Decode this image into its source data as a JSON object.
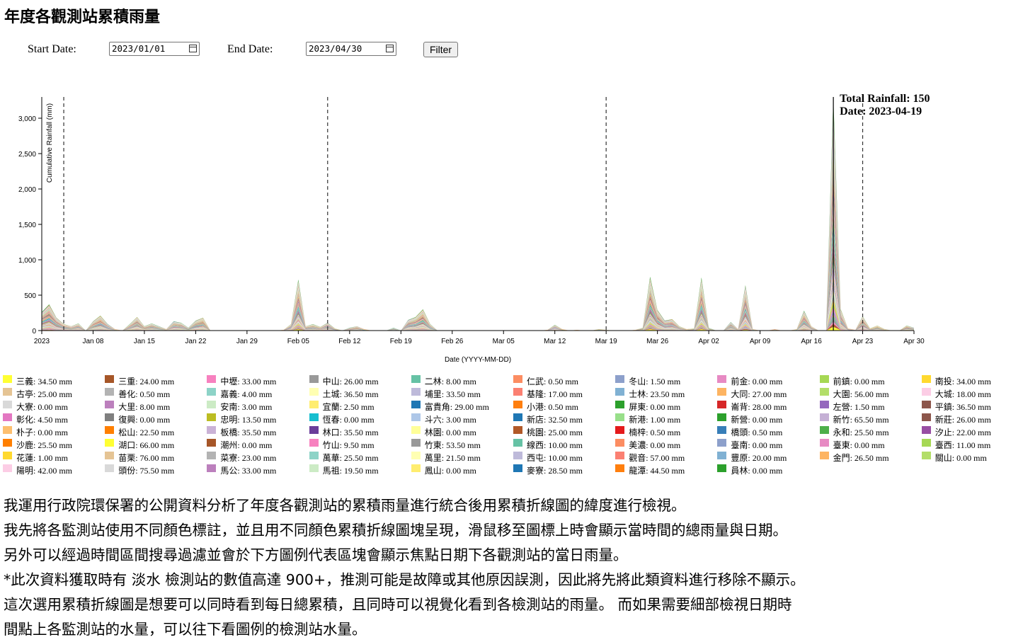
{
  "page_title": "年度各觀測站累積雨量",
  "filter": {
    "start_label": "Start Date:",
    "start_value": "2023/01/01",
    "end_label": "End Date:",
    "end_value": "2023/04/30",
    "button_label": "Filter"
  },
  "chart_data": {
    "type": "area",
    "stacked": true,
    "ylabel": "Cumulative Rainfall (mm)",
    "xlabel": "Date (YYYY-MM-DD)",
    "x_range": [
      "2023-01-01",
      "2023-04-30"
    ],
    "ylim": [
      0,
      3300
    ],
    "y_ticks": [
      0,
      500,
      1000,
      1500,
      2000,
      2500,
      3000
    ],
    "y_tick_labels": [
      "0",
      "500",
      "1,000",
      "1,500",
      "2,000",
      "2,500",
      "3,000"
    ],
    "x_ticks": [
      {
        "date": "2023-01-01",
        "label": "2023"
      },
      {
        "date": "2023-01-08",
        "label": "Jan 08"
      },
      {
        "date": "2023-01-15",
        "label": "Jan 15"
      },
      {
        "date": "2023-01-22",
        "label": "Jan 22"
      },
      {
        "date": "2023-01-29",
        "label": "Jan 29"
      },
      {
        "date": "2023-02-05",
        "label": "Feb 05"
      },
      {
        "date": "2023-02-12",
        "label": "Feb 12"
      },
      {
        "date": "2023-02-19",
        "label": "Feb 19"
      },
      {
        "date": "2023-02-26",
        "label": "Feb 26"
      },
      {
        "date": "2023-03-05",
        "label": "Mar 05"
      },
      {
        "date": "2023-03-12",
        "label": "Mar 12"
      },
      {
        "date": "2023-03-19",
        "label": "Mar 19"
      },
      {
        "date": "2023-03-26",
        "label": "Mar 26"
      },
      {
        "date": "2023-04-02",
        "label": "Apr 02"
      },
      {
        "date": "2023-04-09",
        "label": "Apr 09"
      },
      {
        "date": "2023-04-16",
        "label": "Apr 16"
      },
      {
        "date": "2023-04-23",
        "label": "Apr 23"
      },
      {
        "date": "2023-04-30",
        "label": "Apr 30"
      }
    ],
    "reference_lines": [
      "2023-01-04",
      "2023-02-09",
      "2023-03-19",
      "2023-04-23"
    ],
    "hover_line": "2023-04-19",
    "hover_label_total": "Total Rainfall: 150",
    "hover_label_date": "Date: 2023-04-19",
    "daily_totals": [
      {
        "date": "2023-01-01",
        "value": 260
      },
      {
        "date": "2023-01-02",
        "value": 370
      },
      {
        "date": "2023-01-03",
        "value": 180
      },
      {
        "date": "2023-01-04",
        "value": 90
      },
      {
        "date": "2023-01-05",
        "value": 60
      },
      {
        "date": "2023-01-06",
        "value": 100
      },
      {
        "date": "2023-01-07",
        "value": 0
      },
      {
        "date": "2023-01-08",
        "value": 130
      },
      {
        "date": "2023-01-09",
        "value": 210
      },
      {
        "date": "2023-01-10",
        "value": 90
      },
      {
        "date": "2023-01-11",
        "value": 20
      },
      {
        "date": "2023-01-12",
        "value": 0
      },
      {
        "date": "2023-01-13",
        "value": 90
      },
      {
        "date": "2023-01-14",
        "value": 190
      },
      {
        "date": "2023-01-15",
        "value": 60
      },
      {
        "date": "2023-01-16",
        "value": 100
      },
      {
        "date": "2023-01-17",
        "value": 60
      },
      {
        "date": "2023-01-18",
        "value": 20
      },
      {
        "date": "2023-01-19",
        "value": 130
      },
      {
        "date": "2023-01-20",
        "value": 110
      },
      {
        "date": "2023-01-21",
        "value": 40
      },
      {
        "date": "2023-01-22",
        "value": 140
      },
      {
        "date": "2023-01-23",
        "value": 180
      },
      {
        "date": "2023-01-24",
        "value": 0
      },
      {
        "date": "2023-01-25",
        "value": 0
      },
      {
        "date": "2023-01-26",
        "value": 0
      },
      {
        "date": "2023-01-27",
        "value": 0
      },
      {
        "date": "2023-01-28",
        "value": 0
      },
      {
        "date": "2023-01-29",
        "value": 0
      },
      {
        "date": "2023-01-30",
        "value": 0
      },
      {
        "date": "2023-01-31",
        "value": 0
      },
      {
        "date": "2023-02-01",
        "value": 0
      },
      {
        "date": "2023-02-02",
        "value": 0
      },
      {
        "date": "2023-02-03",
        "value": 10
      },
      {
        "date": "2023-02-04",
        "value": 90
      },
      {
        "date": "2023-02-05",
        "value": 720
      },
      {
        "date": "2023-02-06",
        "value": 60
      },
      {
        "date": "2023-02-07",
        "value": 90
      },
      {
        "date": "2023-02-08",
        "value": 50
      },
      {
        "date": "2023-02-09",
        "value": 110
      },
      {
        "date": "2023-02-10",
        "value": 30
      },
      {
        "date": "2023-02-11",
        "value": 0
      },
      {
        "date": "2023-02-12",
        "value": 40
      },
      {
        "date": "2023-02-13",
        "value": 60
      },
      {
        "date": "2023-02-14",
        "value": 20
      },
      {
        "date": "2023-02-15",
        "value": 0
      },
      {
        "date": "2023-02-16",
        "value": 0
      },
      {
        "date": "2023-02-17",
        "value": 0
      },
      {
        "date": "2023-02-18",
        "value": 40
      },
      {
        "date": "2023-02-19",
        "value": 0
      },
      {
        "date": "2023-02-20",
        "value": 150
      },
      {
        "date": "2023-02-21",
        "value": 190
      },
      {
        "date": "2023-02-22",
        "value": 300
      },
      {
        "date": "2023-02-23",
        "value": 90
      },
      {
        "date": "2023-02-24",
        "value": 0
      },
      {
        "date": "2023-02-25",
        "value": 0
      },
      {
        "date": "2023-02-26",
        "value": 0
      },
      {
        "date": "2023-02-27",
        "value": 0
      },
      {
        "date": "2023-02-28",
        "value": 0
      },
      {
        "date": "2023-03-01",
        "value": 0
      },
      {
        "date": "2023-03-02",
        "value": 0
      },
      {
        "date": "2023-03-03",
        "value": 0
      },
      {
        "date": "2023-03-04",
        "value": 0
      },
      {
        "date": "2023-03-05",
        "value": 0
      },
      {
        "date": "2023-03-06",
        "value": 0
      },
      {
        "date": "2023-03-07",
        "value": 0
      },
      {
        "date": "2023-03-08",
        "value": 0
      },
      {
        "date": "2023-03-09",
        "value": 0
      },
      {
        "date": "2023-03-10",
        "value": 0
      },
      {
        "date": "2023-03-11",
        "value": 10
      },
      {
        "date": "2023-03-12",
        "value": 80
      },
      {
        "date": "2023-03-13",
        "value": 20
      },
      {
        "date": "2023-03-14",
        "value": 0
      },
      {
        "date": "2023-03-15",
        "value": 10
      },
      {
        "date": "2023-03-16",
        "value": 0
      },
      {
        "date": "2023-03-17",
        "value": 0
      },
      {
        "date": "2023-03-18",
        "value": 20
      },
      {
        "date": "2023-03-19",
        "value": 10
      },
      {
        "date": "2023-03-20",
        "value": 0
      },
      {
        "date": "2023-03-21",
        "value": 0
      },
      {
        "date": "2023-03-22",
        "value": 0
      },
      {
        "date": "2023-03-23",
        "value": 10
      },
      {
        "date": "2023-03-24",
        "value": 40
      },
      {
        "date": "2023-03-25",
        "value": 760
      },
      {
        "date": "2023-03-26",
        "value": 290
      },
      {
        "date": "2023-03-27",
        "value": 140
      },
      {
        "date": "2023-03-28",
        "value": 160
      },
      {
        "date": "2023-03-29",
        "value": 60
      },
      {
        "date": "2023-03-30",
        "value": 20
      },
      {
        "date": "2023-03-31",
        "value": 30
      },
      {
        "date": "2023-04-01",
        "value": 750
      },
      {
        "date": "2023-04-02",
        "value": 40
      },
      {
        "date": "2023-04-03",
        "value": 0
      },
      {
        "date": "2023-04-04",
        "value": 0
      },
      {
        "date": "2023-04-05",
        "value": 120
      },
      {
        "date": "2023-04-06",
        "value": 20
      },
      {
        "date": "2023-04-07",
        "value": 640
      },
      {
        "date": "2023-04-08",
        "value": 20
      },
      {
        "date": "2023-04-09",
        "value": 0
      },
      {
        "date": "2023-04-10",
        "value": 0
      },
      {
        "date": "2023-04-11",
        "value": 20
      },
      {
        "date": "2023-04-12",
        "value": 0
      },
      {
        "date": "2023-04-13",
        "value": 0
      },
      {
        "date": "2023-04-14",
        "value": 20
      },
      {
        "date": "2023-04-15",
        "value": 280
      },
      {
        "date": "2023-04-16",
        "value": 60
      },
      {
        "date": "2023-04-17",
        "value": 0
      },
      {
        "date": "2023-04-18",
        "value": 0
      },
      {
        "date": "2023-04-19",
        "value": 3280
      },
      {
        "date": "2023-04-20",
        "value": 300
      },
      {
        "date": "2023-04-21",
        "value": 30
      },
      {
        "date": "2023-04-22",
        "value": 10
      },
      {
        "date": "2023-04-23",
        "value": 200
      },
      {
        "date": "2023-04-24",
        "value": 30
      },
      {
        "date": "2023-04-25",
        "value": 70
      },
      {
        "date": "2023-04-26",
        "value": 20
      },
      {
        "date": "2023-04-27",
        "value": 0
      },
      {
        "date": "2023-04-28",
        "value": 0
      },
      {
        "date": "2023-04-29",
        "value": 70
      },
      {
        "date": "2023-04-30",
        "value": 40
      }
    ]
  },
  "legend": [
    {
      "text": "三義: 34.50 mm",
      "color": "#ffff33"
    },
    {
      "text": "三重: 24.00 mm",
      "color": "#a65628"
    },
    {
      "text": "中壢: 33.00 mm",
      "color": "#f781bf"
    },
    {
      "text": "中山: 26.00 mm",
      "color": "#999999"
    },
    {
      "text": "二林: 8.00 mm",
      "color": "#66c2a5"
    },
    {
      "text": "仁武: 0.50 mm",
      "color": "#fc8d62"
    },
    {
      "text": "冬山: 1.50 mm",
      "color": "#8da0cb"
    },
    {
      "text": "前金: 0.00 mm",
      "color": "#e78ac3"
    },
    {
      "text": "前鎮: 0.00 mm",
      "color": "#a6d854"
    },
    {
      "text": "南投: 34.00 mm",
      "color": "#ffd92f"
    },
    {
      "text": "古亭: 25.00 mm",
      "color": "#e5c494"
    },
    {
      "text": "善化: 0.50 mm",
      "color": "#b3b3b3"
    },
    {
      "text": "嘉義: 4.00 mm",
      "color": "#8dd3c7"
    },
    {
      "text": "土城: 36.50 mm",
      "color": "#ffffb3"
    },
    {
      "text": "埔里: 33.50 mm",
      "color": "#bebada"
    },
    {
      "text": "基隆: 17.00 mm",
      "color": "#fb8072"
    },
    {
      "text": "士林: 23.50 mm",
      "color": "#80b1d3"
    },
    {
      "text": "大同: 27.00 mm",
      "color": "#fdb462"
    },
    {
      "text": "大園: 56.00 mm",
      "color": "#b3de69"
    },
    {
      "text": "大城: 18.00 mm",
      "color": "#fccde5"
    },
    {
      "text": "大寮: 0.00 mm",
      "color": "#d9d9d9"
    },
    {
      "text": "大里: 8.00 mm",
      "color": "#bc80bd"
    },
    {
      "text": "安南: 3.00 mm",
      "color": "#ccebc5"
    },
    {
      "text": "宜蘭: 2.50 mm",
      "color": "#ffed6f"
    },
    {
      "text": "富貴角: 29.00 mm",
      "color": "#1f77b4"
    },
    {
      "text": "小港: 0.50 mm",
      "color": "#ff7f0e"
    },
    {
      "text": "屏東: 0.00 mm",
      "color": "#2ca02c"
    },
    {
      "text": "崙背: 28.00 mm",
      "color": "#d62728"
    },
    {
      "text": "左營: 1.50 mm",
      "color": "#9467bd"
    },
    {
      "text": "平鎮: 36.50 mm",
      "color": "#8c564b"
    },
    {
      "text": "彰化: 4.50 mm",
      "color": "#e377c2"
    },
    {
      "text": "復興: 0.00 mm",
      "color": "#7f7f7f"
    },
    {
      "text": "忠明: 13.50 mm",
      "color": "#bcbd22"
    },
    {
      "text": "恆春: 0.00 mm",
      "color": "#17becf"
    },
    {
      "text": "斗六: 3.00 mm",
      "color": "#aec7e8"
    },
    {
      "text": "新店: 32.50 mm",
      "color": "#1f77b4"
    },
    {
      "text": "新港: 1.00 mm",
      "color": "#98df8a"
    },
    {
      "text": "新營: 0.00 mm",
      "color": "#2ca02c"
    },
    {
      "text": "新竹: 65.50 mm",
      "color": "#c5b0d5"
    },
    {
      "text": "新莊: 26.00 mm",
      "color": "#8c564b"
    },
    {
      "text": "朴子: 0.00 mm",
      "color": "#fdbf6f"
    },
    {
      "text": "松山: 22.50 mm",
      "color": "#ff7f00"
    },
    {
      "text": "板橋: 35.50 mm",
      "color": "#cab2d6"
    },
    {
      "text": "林口: 35.50 mm",
      "color": "#6a3d9a"
    },
    {
      "text": "林園: 0.00 mm",
      "color": "#ffff99"
    },
    {
      "text": "桃園: 25.00 mm",
      "color": "#b15928"
    },
    {
      "text": "楠梓: 0.50 mm",
      "color": "#e41a1c"
    },
    {
      "text": "橋頭: 0.50 mm",
      "color": "#377eb8"
    },
    {
      "text": "永和: 25.50 mm",
      "color": "#4daf4a"
    },
    {
      "text": "汐止: 22.00 mm",
      "color": "#984ea3"
    },
    {
      "text": "沙鹿: 25.50 mm",
      "color": "#ff7f00"
    },
    {
      "text": "湖口: 66.00 mm",
      "color": "#ffff33"
    },
    {
      "text": "潮州: 0.00 mm",
      "color": "#a65628"
    },
    {
      "text": "竹山: 9.50 mm",
      "color": "#f781bf"
    },
    {
      "text": "竹東: 53.50 mm",
      "color": "#999999"
    },
    {
      "text": "線西: 10.00 mm",
      "color": "#66c2a5"
    },
    {
      "text": "美濃: 0.00 mm",
      "color": "#fc8d62"
    },
    {
      "text": "臺南: 0.00 mm",
      "color": "#8da0cb"
    },
    {
      "text": "臺東: 0.00 mm",
      "color": "#e78ac3"
    },
    {
      "text": "臺西: 11.00 mm",
      "color": "#a6d854"
    },
    {
      "text": "花蓮: 1.00 mm",
      "color": "#ffd92f"
    },
    {
      "text": "苗栗: 76.00 mm",
      "color": "#e5c494"
    },
    {
      "text": "菜寮: 23.00 mm",
      "color": "#b3b3b3"
    },
    {
      "text": "萬華: 25.50 mm",
      "color": "#8dd3c7"
    },
    {
      "text": "萬里: 21.50 mm",
      "color": "#ffffb3"
    },
    {
      "text": "西屯: 10.00 mm",
      "color": "#bebada"
    },
    {
      "text": "觀音: 57.00 mm",
      "color": "#fb8072"
    },
    {
      "text": "豐原: 20.00 mm",
      "color": "#80b1d3"
    },
    {
      "text": "金門: 26.50 mm",
      "color": "#fdb462"
    },
    {
      "text": "關山: 0.00 mm",
      "color": "#b3de69"
    },
    {
      "text": "陽明: 42.00 mm",
      "color": "#fccde5"
    },
    {
      "text": "頭份: 75.50 mm",
      "color": "#d9d9d9"
    },
    {
      "text": "馬公: 33.00 mm",
      "color": "#bc80bd"
    },
    {
      "text": "馬祖: 19.50 mm",
      "color": "#ccebc5"
    },
    {
      "text": "鳳山: 0.00 mm",
      "color": "#ffed6f"
    },
    {
      "text": "麥寮: 28.50 mm",
      "color": "#1f77b4"
    },
    {
      "text": "龍潭: 44.50 mm",
      "color": "#ff7f0e"
    },
    {
      "text": "員林: 0.00 mm",
      "color": "#2ca02c"
    }
  ],
  "description": [
    "我運用行政院環保署的公開資料分析了年度各觀測站的累積雨量進行統合後用累積折線圖的緯度進行檢視。",
    "我先將各監測站使用不同顏色標註，並且用不同顏色累積折線圖塊呈現，滑鼠移至圖標上時會顯示當時間的總雨量與日期。",
    "另外可以經過時間區間搜尋過濾並會於下方圖例代表區塊會顯示焦點日期下各觀測站的當日雨量。",
    "*此次資料獲取時有 淡水 檢測站的數值高達 900+，推測可能是故障或其他原因誤測，因此將先將此類資料進行移除不顯示。",
    "這次選用累積折線圖是想要可以同時看到每日總累積，且同時可以視覺化看到各檢測站的雨量。 而如果需要細部檢視日期時",
    "間點上各監測站的水量，可以往下看圖例的檢測站水量。"
  ]
}
